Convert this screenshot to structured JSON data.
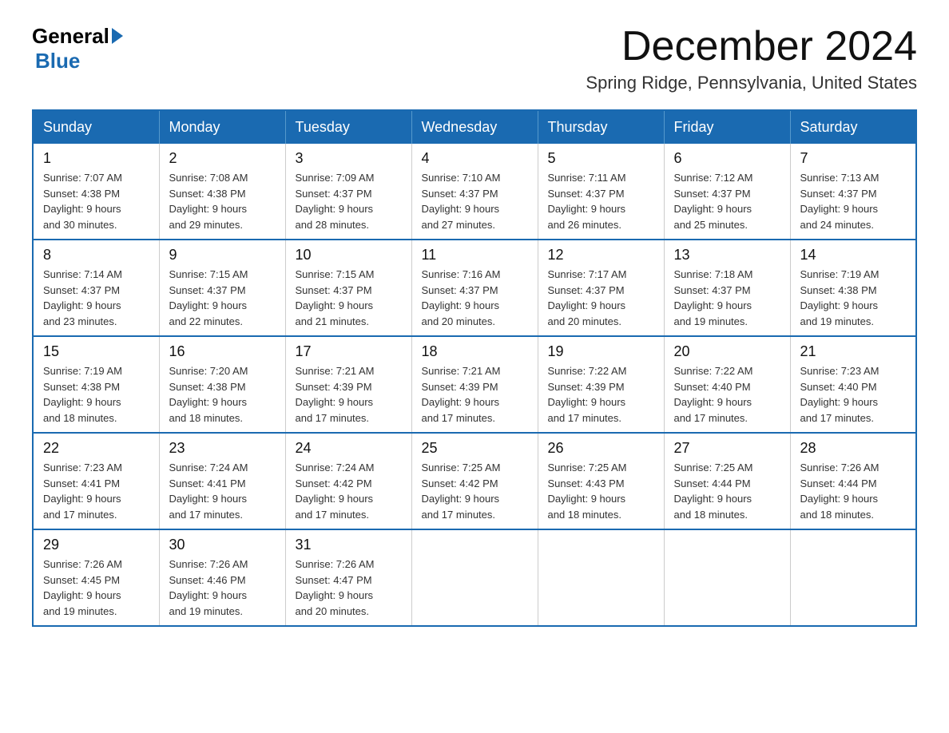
{
  "header": {
    "logo_general": "General",
    "logo_blue": "Blue",
    "month_title": "December 2024",
    "location": "Spring Ridge, Pennsylvania, United States"
  },
  "weekdays": [
    "Sunday",
    "Monday",
    "Tuesday",
    "Wednesday",
    "Thursday",
    "Friday",
    "Saturday"
  ],
  "weeks": [
    [
      {
        "day": "1",
        "sunrise": "7:07 AM",
        "sunset": "4:38 PM",
        "daylight": "9 hours and 30 minutes."
      },
      {
        "day": "2",
        "sunrise": "7:08 AM",
        "sunset": "4:38 PM",
        "daylight": "9 hours and 29 minutes."
      },
      {
        "day": "3",
        "sunrise": "7:09 AM",
        "sunset": "4:37 PM",
        "daylight": "9 hours and 28 minutes."
      },
      {
        "day": "4",
        "sunrise": "7:10 AM",
        "sunset": "4:37 PM",
        "daylight": "9 hours and 27 minutes."
      },
      {
        "day": "5",
        "sunrise": "7:11 AM",
        "sunset": "4:37 PM",
        "daylight": "9 hours and 26 minutes."
      },
      {
        "day": "6",
        "sunrise": "7:12 AM",
        "sunset": "4:37 PM",
        "daylight": "9 hours and 25 minutes."
      },
      {
        "day": "7",
        "sunrise": "7:13 AM",
        "sunset": "4:37 PM",
        "daylight": "9 hours and 24 minutes."
      }
    ],
    [
      {
        "day": "8",
        "sunrise": "7:14 AM",
        "sunset": "4:37 PM",
        "daylight": "9 hours and 23 minutes."
      },
      {
        "day": "9",
        "sunrise": "7:15 AM",
        "sunset": "4:37 PM",
        "daylight": "9 hours and 22 minutes."
      },
      {
        "day": "10",
        "sunrise": "7:15 AM",
        "sunset": "4:37 PM",
        "daylight": "9 hours and 21 minutes."
      },
      {
        "day": "11",
        "sunrise": "7:16 AM",
        "sunset": "4:37 PM",
        "daylight": "9 hours and 20 minutes."
      },
      {
        "day": "12",
        "sunrise": "7:17 AM",
        "sunset": "4:37 PM",
        "daylight": "9 hours and 20 minutes."
      },
      {
        "day": "13",
        "sunrise": "7:18 AM",
        "sunset": "4:37 PM",
        "daylight": "9 hours and 19 minutes."
      },
      {
        "day": "14",
        "sunrise": "7:19 AM",
        "sunset": "4:38 PM",
        "daylight": "9 hours and 19 minutes."
      }
    ],
    [
      {
        "day": "15",
        "sunrise": "7:19 AM",
        "sunset": "4:38 PM",
        "daylight": "9 hours and 18 minutes."
      },
      {
        "day": "16",
        "sunrise": "7:20 AM",
        "sunset": "4:38 PM",
        "daylight": "9 hours and 18 minutes."
      },
      {
        "day": "17",
        "sunrise": "7:21 AM",
        "sunset": "4:39 PM",
        "daylight": "9 hours and 17 minutes."
      },
      {
        "day": "18",
        "sunrise": "7:21 AM",
        "sunset": "4:39 PM",
        "daylight": "9 hours and 17 minutes."
      },
      {
        "day": "19",
        "sunrise": "7:22 AM",
        "sunset": "4:39 PM",
        "daylight": "9 hours and 17 minutes."
      },
      {
        "day": "20",
        "sunrise": "7:22 AM",
        "sunset": "4:40 PM",
        "daylight": "9 hours and 17 minutes."
      },
      {
        "day": "21",
        "sunrise": "7:23 AM",
        "sunset": "4:40 PM",
        "daylight": "9 hours and 17 minutes."
      }
    ],
    [
      {
        "day": "22",
        "sunrise": "7:23 AM",
        "sunset": "4:41 PM",
        "daylight": "9 hours and 17 minutes."
      },
      {
        "day": "23",
        "sunrise": "7:24 AM",
        "sunset": "4:41 PM",
        "daylight": "9 hours and 17 minutes."
      },
      {
        "day": "24",
        "sunrise": "7:24 AM",
        "sunset": "4:42 PM",
        "daylight": "9 hours and 17 minutes."
      },
      {
        "day": "25",
        "sunrise": "7:25 AM",
        "sunset": "4:42 PM",
        "daylight": "9 hours and 17 minutes."
      },
      {
        "day": "26",
        "sunrise": "7:25 AM",
        "sunset": "4:43 PM",
        "daylight": "9 hours and 18 minutes."
      },
      {
        "day": "27",
        "sunrise": "7:25 AM",
        "sunset": "4:44 PM",
        "daylight": "9 hours and 18 minutes."
      },
      {
        "day": "28",
        "sunrise": "7:26 AM",
        "sunset": "4:44 PM",
        "daylight": "9 hours and 18 minutes."
      }
    ],
    [
      {
        "day": "29",
        "sunrise": "7:26 AM",
        "sunset": "4:45 PM",
        "daylight": "9 hours and 19 minutes."
      },
      {
        "day": "30",
        "sunrise": "7:26 AM",
        "sunset": "4:46 PM",
        "daylight": "9 hours and 19 minutes."
      },
      {
        "day": "31",
        "sunrise": "7:26 AM",
        "sunset": "4:47 PM",
        "daylight": "9 hours and 20 minutes."
      },
      null,
      null,
      null,
      null
    ]
  ],
  "labels": {
    "sunrise": "Sunrise:",
    "sunset": "Sunset:",
    "daylight": "Daylight:"
  }
}
